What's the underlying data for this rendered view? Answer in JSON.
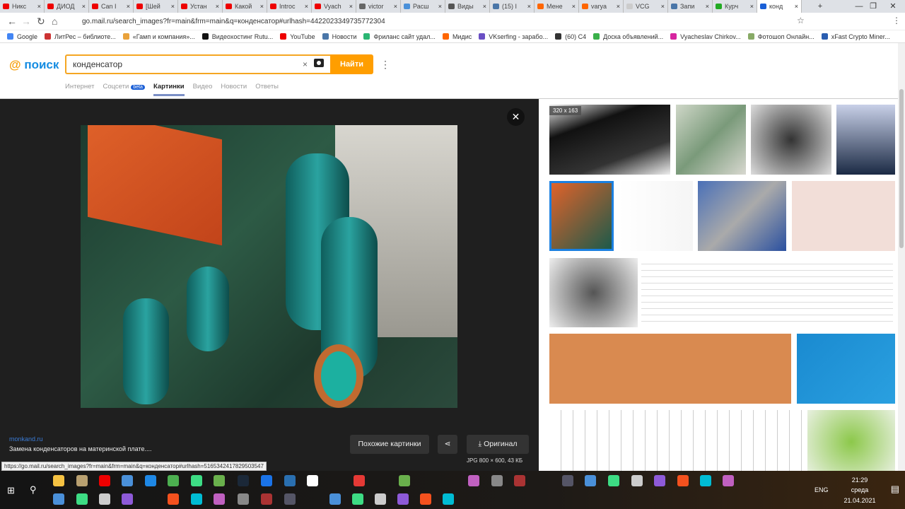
{
  "browser": {
    "tabs": [
      {
        "title": "Никс",
        "color": "#e00"
      },
      {
        "title": "ДИОД",
        "color": "#e00"
      },
      {
        "title": "Can I",
        "color": "#e00"
      },
      {
        "title": "[Шей",
        "color": "#e00"
      },
      {
        "title": "Устан",
        "color": "#e00"
      },
      {
        "title": "Какой",
        "color": "#e00"
      },
      {
        "title": "Introc",
        "color": "#e00"
      },
      {
        "title": "Vyach",
        "color": "#e00"
      },
      {
        "title": "victor",
        "color": "#666"
      },
      {
        "title": "Расш",
        "color": "#4a90d9"
      },
      {
        "title": "Виды",
        "color": "#555"
      },
      {
        "title": "(15) I",
        "color": "#4a76a8"
      },
      {
        "title": "Мене",
        "color": "#f60"
      },
      {
        "title": "varya",
        "color": "#f60"
      },
      {
        "title": "VCG",
        "color": "#ccc"
      },
      {
        "title": "Запи",
        "color": "#4a76a8"
      },
      {
        "title": "Курч",
        "color": "#2a2"
      },
      {
        "title": "конд",
        "color": "#1a5fd6"
      }
    ],
    "url": "go.mail.ru/search_images?fr=main&frm=main&q=конденсатор#urlhash=4422023349735772304",
    "bookmarks": [
      {
        "label": "Google",
        "color": "#4285f4"
      },
      {
        "label": "ЛитРес – библиоте...",
        "color": "#c33"
      },
      {
        "label": "«Гамп и компания»...",
        "color": "#e9a23b"
      },
      {
        "label": "Видеохостинг Rutu...",
        "color": "#111"
      },
      {
        "label": "YouTube",
        "color": "#e00"
      },
      {
        "label": "Новости",
        "color": "#4a76a8"
      },
      {
        "label": "Фриланс сайт удал...",
        "color": "#2bb673"
      },
      {
        "label": "Мидис",
        "color": "#f60"
      },
      {
        "label": "VKserfing - зарабо...",
        "color": "#6a4fc4"
      },
      {
        "label": "(60) С4",
        "color": "#333"
      },
      {
        "label": "Доска объявлений...",
        "color": "#3ab04a"
      },
      {
        "label": "Vyacheslav Chirkov...",
        "color": "#d6249f"
      },
      {
        "label": "Фотошоп Онлайн...",
        "color": "#8a6"
      },
      {
        "label": "xFast Crypto Miner...",
        "color": "#2a5db0"
      }
    ]
  },
  "header": {
    "logo": "поиск",
    "query": "конденсатор",
    "find_label": "Найти",
    "tabs": [
      "Интернет",
      "Соцсети",
      "Картинки",
      "Видео",
      "Новости",
      "Ответы"
    ],
    "beta": "beta"
  },
  "viewer": {
    "source": "monkand.ru",
    "title": "Замена конденсаторов на материнской плате....",
    "similar_label": "Похожие картинки",
    "original_label": "Оригинал",
    "file_info": "JPG 800 × 600, 43 КБ",
    "close": "✕"
  },
  "thumbs": {
    "size_badge": "320 x 163"
  },
  "status_url": "https://go.mail.ru/search_images?fr=main&frm=main&q=конденсатор#urlhash=5165342417829503547",
  "taskbar": {
    "time": "21:29",
    "day": "среда",
    "date": "21.04.2021",
    "lang": "ENG"
  }
}
